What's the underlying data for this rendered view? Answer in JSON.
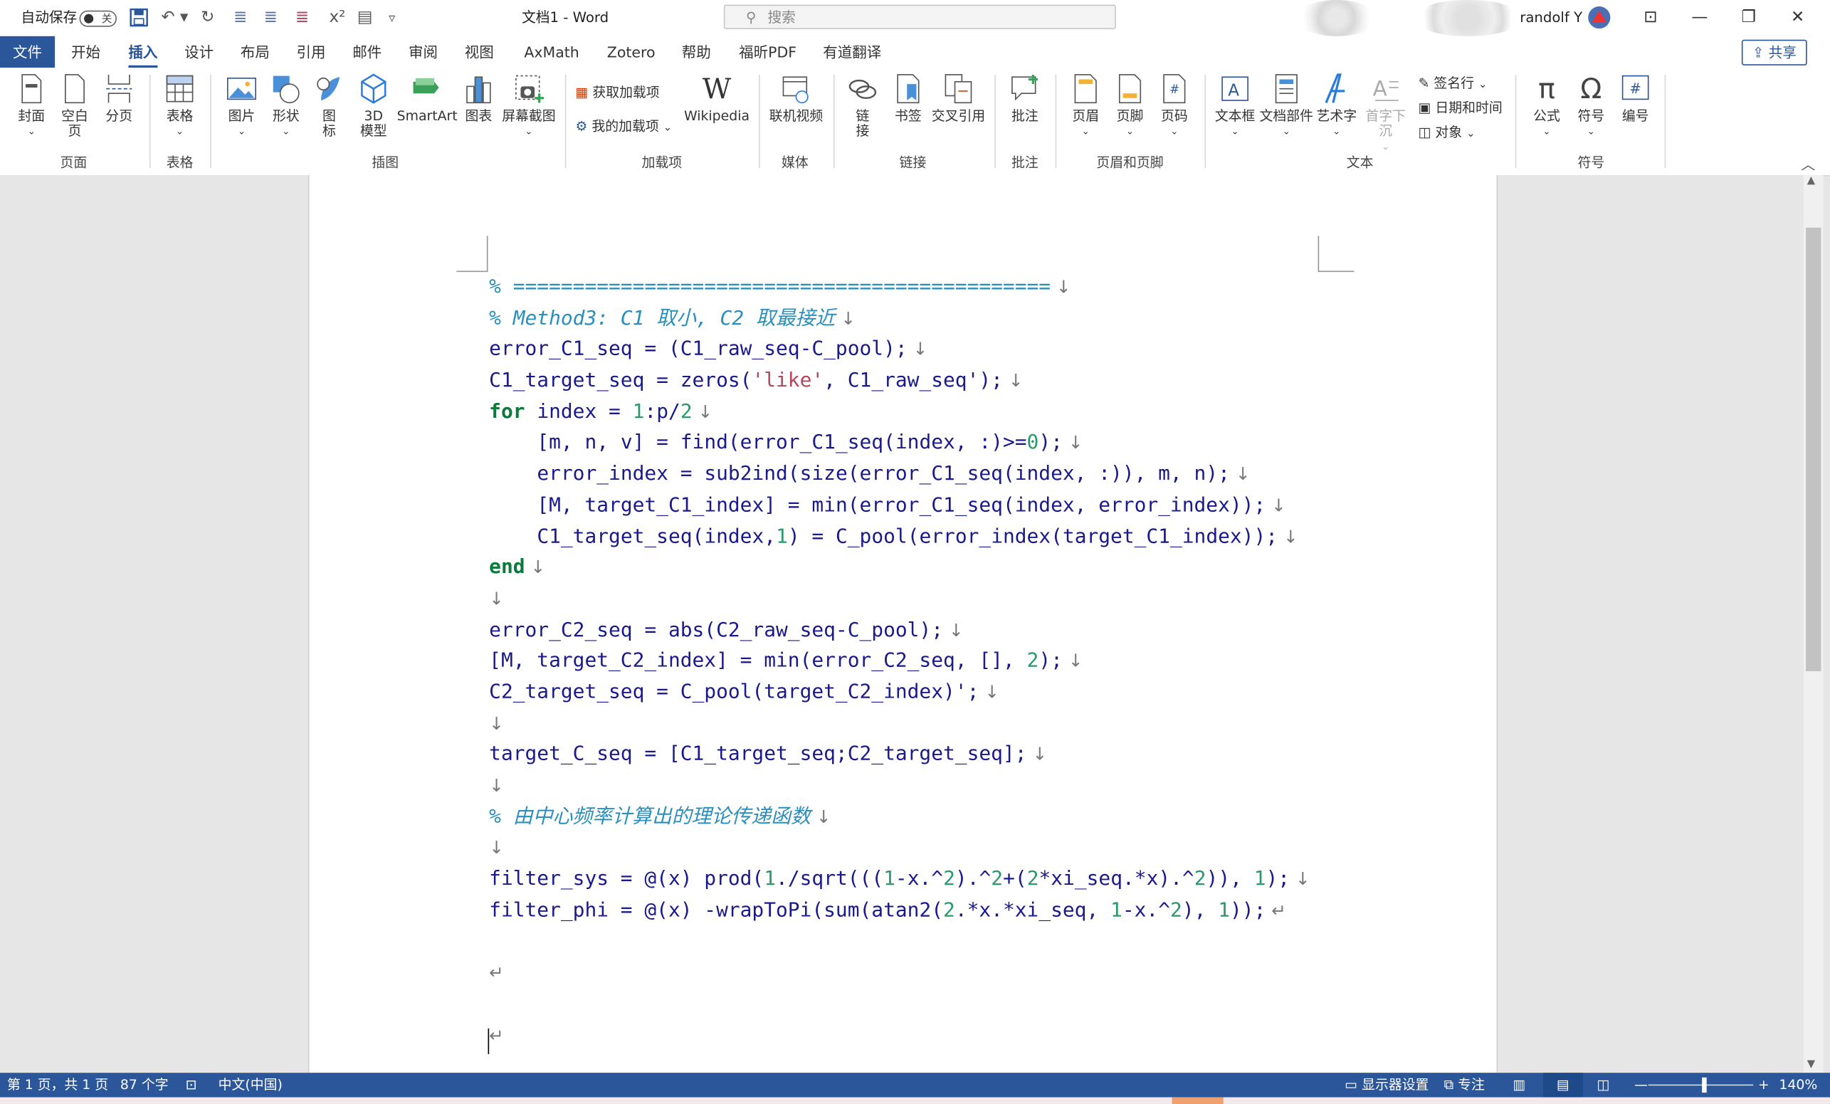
{
  "titlebar": {
    "autosave_label": "自动保存",
    "autosave_state": "关",
    "doc_title": "文档1  -  Word",
    "search_placeholder": "搜索",
    "user_name": "randolf Y"
  },
  "tabs": [
    "文件",
    "开始",
    "插入",
    "设计",
    "布局",
    "引用",
    "邮件",
    "审阅",
    "视图",
    "AxMath",
    "Zotero",
    "帮助",
    "福昕PDF",
    "有道翻译"
  ],
  "active_tab": "插入",
  "share_label": "共享",
  "ribbon": {
    "buttons": {
      "cover": "封面",
      "blank": "空白页",
      "pagebreak": "分页",
      "table": "表格",
      "picture": "图片",
      "shapes": "形状",
      "icons": "图\n标",
      "model3d": "3D\n模型",
      "smartart": "SmartArt",
      "chart": "图表",
      "screenshot": "屏幕截图",
      "get_addins": "获取加载项",
      "my_addins": "我的加载项",
      "wikipedia": "Wikipedia",
      "online_video": "联机视频",
      "link": "链\n接",
      "bookmark": "书签",
      "crossref": "交叉引用",
      "comment": "批注",
      "header": "页眉",
      "footer": "页脚",
      "pagenum": "页码",
      "textbox": "文本框",
      "quickparts": "文档部件",
      "wordart": "艺术字",
      "dropcap": "首字下沉",
      "signature": "签名行",
      "datetime": "日期和时间",
      "object": "对象",
      "equation": "公式",
      "symbol": "符号",
      "number": "编号"
    },
    "groups": {
      "pages": "页面",
      "tables": "表格",
      "illustrations": "插图",
      "addins": "加载项",
      "media": "媒体",
      "links": "链接",
      "comments": "批注",
      "headerfooter": "页眉和页脚",
      "text": "文本",
      "symbols": "符号"
    }
  },
  "code_lines": [
    {
      "indent": 0,
      "tokens": [
        [
          "cm",
          "% ============================================="
        ]
      ],
      "mark": "↓"
    },
    {
      "indent": 0,
      "tokens": [
        [
          "cm",
          "% Method3: C1 取小, C2 取最接近"
        ]
      ],
      "mark": "↓"
    },
    {
      "indent": 0,
      "tokens": [
        [
          "tx",
          "error_C1_seq = (C1_raw_seq-C_pool);"
        ]
      ],
      "mark": "↓"
    },
    {
      "indent": 0,
      "tokens": [
        [
          "tx",
          "C1_target_seq = zeros("
        ],
        [
          "st",
          "'like'"
        ],
        [
          "tx",
          ", C1_raw_seq');"
        ]
      ],
      "mark": "↓"
    },
    {
      "indent": 0,
      "tokens": [
        [
          "kw",
          "for"
        ],
        [
          "tx",
          " index = "
        ],
        [
          "nm",
          "1"
        ],
        [
          "tx",
          ":p/"
        ],
        [
          "nm",
          "2"
        ]
      ],
      "mark": "↓"
    },
    {
      "indent": 1,
      "tokens": [
        [
          "tx",
          "[m, n, v] = find(error_C1_seq(index, :)>="
        ],
        [
          "nm",
          "0"
        ],
        [
          "tx",
          ");"
        ]
      ],
      "mark": "↓"
    },
    {
      "indent": 1,
      "tokens": [
        [
          "tx",
          "error_index = sub2ind(size(error_C1_seq(index, :)), m, n);"
        ]
      ],
      "mark": "↓"
    },
    {
      "indent": 1,
      "tokens": [
        [
          "tx",
          "[M, target_C1_index] = min(error_C1_seq(index, error_index));"
        ]
      ],
      "mark": "↓"
    },
    {
      "indent": 1,
      "tokens": [
        [
          "tx",
          "C1_target_seq(index,"
        ],
        [
          "nm",
          "1"
        ],
        [
          "tx",
          ") = C_pool(error_index(target_C1_index));"
        ]
      ],
      "mark": "↓"
    },
    {
      "indent": 0,
      "tokens": [
        [
          "kw",
          "end"
        ]
      ],
      "mark": "↓"
    },
    {
      "indent": 0,
      "tokens": [],
      "mark": "↓"
    },
    {
      "indent": 0,
      "tokens": [
        [
          "tx",
          "error_C2_seq = abs(C2_raw_seq-C_pool);"
        ]
      ],
      "mark": "↓"
    },
    {
      "indent": 0,
      "tokens": [
        [
          "tx",
          "[M, target_C2_index] = min(error_C2_seq, [], "
        ],
        [
          "nm",
          "2"
        ],
        [
          "tx",
          ");"
        ]
      ],
      "mark": "↓"
    },
    {
      "indent": 0,
      "tokens": [
        [
          "tx",
          "C2_target_seq = C_pool(target_C2_index)';"
        ]
      ],
      "mark": "↓"
    },
    {
      "indent": 0,
      "tokens": [],
      "mark": "↓"
    },
    {
      "indent": 0,
      "tokens": [
        [
          "tx",
          "target_C_seq = [C1_target_seq;C2_target_seq];"
        ]
      ],
      "mark": "↓"
    },
    {
      "indent": 0,
      "tokens": [],
      "mark": "↓"
    },
    {
      "indent": 0,
      "tokens": [
        [
          "cm",
          "% 由中心频率计算出的理论传递函数"
        ]
      ],
      "mark": "↓"
    },
    {
      "indent": 0,
      "tokens": [],
      "mark": "↓"
    },
    {
      "indent": 0,
      "tokens": [
        [
          "tx",
          "filter_sys = @(x) prod("
        ],
        [
          "nm",
          "1"
        ],
        [
          "tx",
          "./sqrt((("
        ],
        [
          "nm",
          "1"
        ],
        [
          "tx",
          "-x.^"
        ],
        [
          "nm",
          "2"
        ],
        [
          "tx",
          ").^"
        ],
        [
          "nm",
          "2"
        ],
        [
          "tx",
          "+("
        ],
        [
          "nm",
          "2"
        ],
        [
          "tx",
          "*xi_seq.*x).^"
        ],
        [
          "nm",
          "2"
        ],
        [
          "tx",
          ")), "
        ],
        [
          "nm",
          "1"
        ],
        [
          "tx",
          ");"
        ]
      ],
      "mark": "↓"
    },
    {
      "indent": 0,
      "tokens": [
        [
          "tx",
          "filter_phi = @(x) -wrapToPi(sum(atan2("
        ],
        [
          "nm",
          "2"
        ],
        [
          "tx",
          ".*x.*xi_seq, "
        ],
        [
          "nm",
          "1"
        ],
        [
          "tx",
          "-x.^"
        ],
        [
          "nm",
          "2"
        ],
        [
          "tx",
          "), "
        ],
        [
          "nm",
          "1"
        ],
        [
          "tx",
          "));"
        ]
      ],
      "mark": "↵"
    },
    {
      "indent": 0,
      "tokens": [],
      "mark": ""
    },
    {
      "indent": 0,
      "tokens": [],
      "mark": "↵"
    },
    {
      "indent": 0,
      "tokens": [],
      "mark": ""
    },
    {
      "indent": 0,
      "tokens": [],
      "mark": "↵"
    }
  ],
  "statusbar": {
    "page": "第 1 页，共 1 页",
    "words": "87 个字",
    "language": "中文(中国)",
    "display": "显示器设置",
    "focus": "专注",
    "zoom": "140%"
  },
  "colors": {
    "brand": "#2b579a"
  }
}
